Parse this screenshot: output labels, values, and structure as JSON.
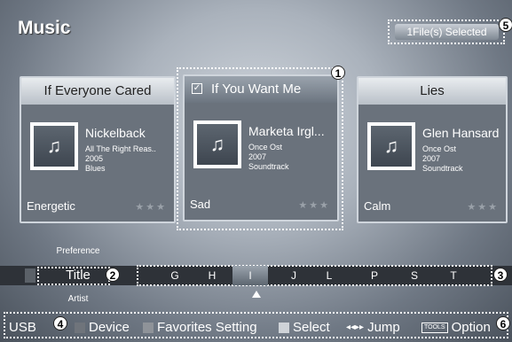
{
  "header": {
    "title": "Music",
    "selected_label": "1File(s) Selected"
  },
  "badges": [
    "1",
    "2",
    "3",
    "4",
    "5",
    "6"
  ],
  "cards": [
    {
      "title": "If Everyone Cared",
      "artist": "Nickelback",
      "album": "All The Right Reas..",
      "year": "2005",
      "genre": "Blues",
      "mood": "Energetic",
      "stars": "★★★",
      "checked": ""
    },
    {
      "title": "If You Want Me",
      "artist": "Marketa Irgl...",
      "album": "Once Ost",
      "year": "2007",
      "genre": "Soundtrack",
      "mood": "Sad",
      "stars": "★★★",
      "checked": "✓"
    },
    {
      "title": "Lies",
      "artist": "Glen Hansard",
      "album": "Once Ost",
      "year": "2007",
      "genre": "Soundtrack",
      "mood": "Calm",
      "stars": "★★★",
      "checked": ""
    }
  ],
  "sort_menu": {
    "above": "Preference",
    "current": "Title",
    "below": "Artist"
  },
  "letters": [
    "G",
    "H",
    "I",
    "J",
    "L",
    "P",
    "S",
    "T"
  ],
  "active_letter": "I",
  "footer": {
    "usb": "USB",
    "device": "Device",
    "favorites": "Favorites Setting",
    "select": "Select",
    "jump_icon": "◂◂▸▸",
    "jump": "Jump",
    "tools": "TOOLS",
    "option": "Option"
  },
  "colors": {
    "device": "#6f747b",
    "favorites": "#8f9399",
    "select": "#cfd3d8"
  },
  "icons": {
    "art": "music-note-icon",
    "pointer": "triangle-up-icon"
  }
}
